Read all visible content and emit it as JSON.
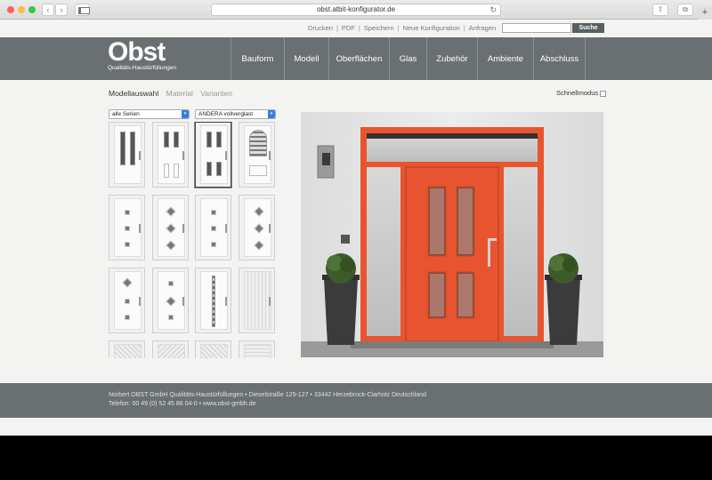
{
  "browser": {
    "url": "obst.atbit-konfigurator.de",
    "back_glyph": "‹",
    "fwd_glyph": "›",
    "reload_glyph": "↻",
    "share_glyph": "⇪",
    "tabs_glyph": "⧉",
    "newtab_glyph": "+"
  },
  "utility": {
    "links": [
      "Drucken",
      "PDF",
      "Speichern",
      "Neue Konfiguration",
      "Anfragen"
    ],
    "separator": "|",
    "search_placeholder": "",
    "search_button": "Suche"
  },
  "logo": {
    "word": "Obst",
    "tagline": "Qualitäts-Haustürfüllungen"
  },
  "nav": [
    "Bauform",
    "Modell",
    "Oberflächen",
    "Glas",
    "Zubehör",
    "Ambiente",
    "Abschluss"
  ],
  "subtabs": {
    "items": [
      "Modellauswahl",
      "Material",
      "Varianten"
    ],
    "active_index": 0
  },
  "quick_mode": {
    "label": "Schnellmodus",
    "checked": false
  },
  "filters": {
    "series": "alle Serien",
    "model": "ANDERA vollverglast"
  },
  "colors": {
    "door": "#e8542f",
    "header": "#6a6f72",
    "accent": "#2f7fe8"
  },
  "footer": {
    "line1": "Norbert OBST GmbH Qualitäts-Haustürfüllungen • Dieselstraße 125-127 • 33442 Herzebrock-Clarholz Deutschland",
    "line2": "Telefon: 00 49 (0) 52 45 86 04-0 • www.obst-gmbh.de"
  }
}
